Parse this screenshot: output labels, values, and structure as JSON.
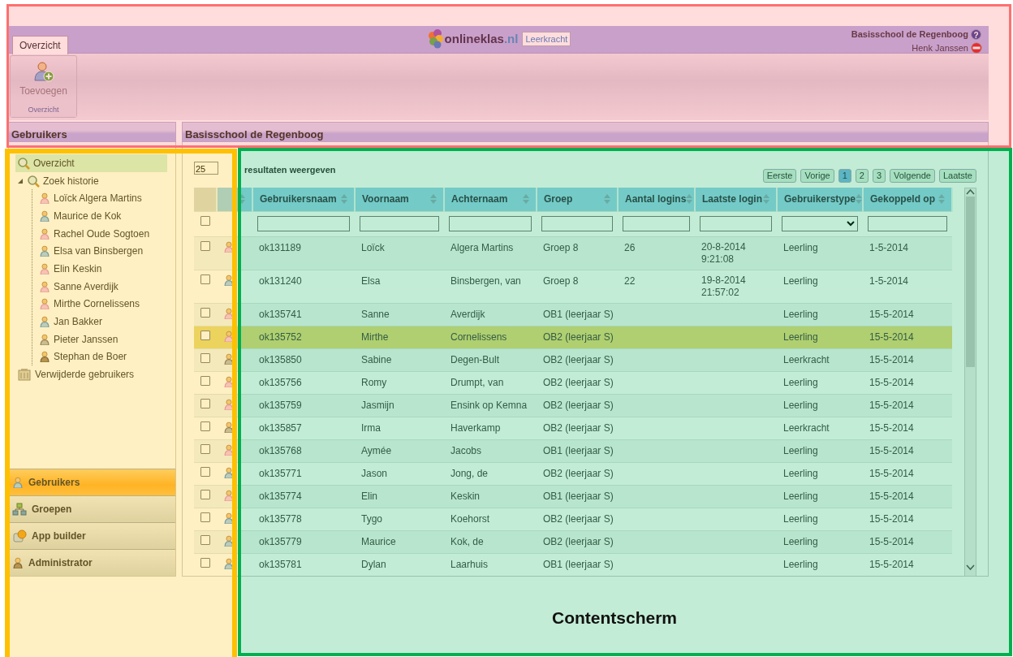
{
  "header": {
    "tab": {
      "label": "Overzicht",
      "selected": true
    },
    "logo_name": "onlineklas",
    "logo_domain": ".nl",
    "role_badge": "Leerkracht",
    "school": "Basisschool de Regenboog",
    "help_icon": "?",
    "user": "Henk Janssen"
  },
  "toolbar": {
    "buttons": [
      {
        "label": "Toevoegen"
      }
    ],
    "group_label": "Overzicht"
  },
  "sidebar": {
    "title": "Gebruikers",
    "tree": [
      {
        "label": "Overzicht",
        "kind": "overview",
        "selected": true
      },
      {
        "label": "Zoek historie",
        "kind": "search",
        "selected": false,
        "expanded": true,
        "children": [
          {
            "label": "Loïck Algera Martins",
            "kind": "girl",
            "selected": false
          },
          {
            "label": "Maurice de Kok",
            "kind": "boy",
            "selected": false
          },
          {
            "label": "Rachel Oude Sogtoen",
            "kind": "girl",
            "selected": false
          },
          {
            "label": "Elsa van Binsbergen",
            "kind": "boy",
            "selected": false
          },
          {
            "label": "Elin Keskin",
            "kind": "girl",
            "selected": false
          },
          {
            "label": "Sanne Averdijk",
            "kind": "girl",
            "selected": false
          },
          {
            "label": "Mirthe Cornelissens",
            "kind": "girl",
            "selected": false
          },
          {
            "label": "Jan Bakker",
            "kind": "boy",
            "selected": false
          },
          {
            "label": "Pieter Janssen",
            "kind": "teacher",
            "selected": false
          },
          {
            "label": "Stephan de Boer",
            "kind": "admin",
            "selected": false
          }
        ]
      },
      {
        "label": "Verwijderde gebruikers",
        "kind": "deleted",
        "selected": false
      }
    ],
    "nav": [
      {
        "label": "Gebruikers",
        "kind": "users",
        "selected": true
      },
      {
        "label": "Groepen",
        "kind": "groups",
        "selected": false
      },
      {
        "label": "App builder",
        "kind": "apps",
        "selected": false
      },
      {
        "label": "Administrator",
        "kind": "admin",
        "selected": false
      }
    ]
  },
  "content": {
    "title": "Basisschool de Regenboog",
    "page_size": "25",
    "page_size_label": "resultaten weergeven",
    "pager": [
      {
        "label": "Eerste",
        "selected": false
      },
      {
        "label": "Vorige",
        "selected": false
      },
      {
        "label": "1",
        "selected": true
      },
      {
        "label": "2",
        "selected": false
      },
      {
        "label": "3",
        "selected": false
      },
      {
        "label": "Volgende",
        "selected": false
      },
      {
        "label": "Laatste",
        "selected": false
      }
    ],
    "table": {
      "select_all": {
        "checked": false
      },
      "columns": [
        {
          "label": "Gebruikersnaam",
          "kind": "text"
        },
        {
          "label": "Voornaam",
          "kind": "text"
        },
        {
          "label": "Achternaam",
          "kind": "text"
        },
        {
          "label": "Groep",
          "kind": "text"
        },
        {
          "label": "Aantal logins",
          "kind": "text"
        },
        {
          "label": "Laatste login",
          "kind": "text"
        },
        {
          "label": "Gebruikerstype",
          "kind": "select"
        },
        {
          "label": "Gekoppeld op",
          "kind": "text"
        }
      ],
      "rows": [
        {
          "kind": "girl",
          "checked": false,
          "selected": false,
          "cells": [
            "ok131189",
            "Loïck",
            "Algera Martins",
            "Groep 8",
            "26",
            "20-8-2014 9:21:08",
            "Leerling",
            "1-5-2014"
          ]
        },
        {
          "kind": "boy",
          "checked": false,
          "selected": false,
          "cells": [
            "ok131240",
            "Elsa",
            "Binsbergen, van",
            "Groep 8",
            "22",
            "19-8-2014 21:57:02",
            "Leerling",
            "1-5-2014"
          ]
        },
        {
          "kind": "girl",
          "checked": false,
          "selected": false,
          "cells": [
            "ok135741",
            "Sanne",
            "Averdijk",
            "OB1 (leerjaar S)",
            "",
            "",
            "Leerling",
            "15-5-2014"
          ]
        },
        {
          "kind": "girl",
          "checked": false,
          "selected": true,
          "cells": [
            "ok135752",
            "Mirthe",
            "Cornelissens",
            "OB2 (leerjaar S)",
            "",
            "",
            "Leerling",
            "15-5-2014"
          ]
        },
        {
          "kind": "teacher",
          "checked": false,
          "selected": false,
          "cells": [
            "ok135850",
            "Sabine",
            "Degen-Bult",
            "OB2 (leerjaar S)",
            "",
            "",
            "Leerkracht",
            "15-5-2014"
          ]
        },
        {
          "kind": "girl",
          "checked": false,
          "selected": false,
          "cells": [
            "ok135756",
            "Romy",
            "Drumpt, van",
            "OB2 (leerjaar S)",
            "",
            "",
            "Leerling",
            "15-5-2014"
          ]
        },
        {
          "kind": "girl",
          "checked": false,
          "selected": false,
          "cells": [
            "ok135759",
            "Jasmijn",
            "Ensink op Kemna",
            "OB2 (leerjaar S)",
            "",
            "",
            "Leerling",
            "15-5-2014"
          ]
        },
        {
          "kind": "teacher",
          "checked": false,
          "selected": false,
          "cells": [
            "ok135857",
            "Irma",
            "Haverkamp",
            "OB2 (leerjaar S)",
            "",
            "",
            "Leerkracht",
            "15-5-2014"
          ]
        },
        {
          "kind": "girl",
          "checked": false,
          "selected": false,
          "cells": [
            "ok135768",
            "Aymée",
            "Jacobs",
            "OB1 (leerjaar S)",
            "",
            "",
            "Leerling",
            "15-5-2014"
          ]
        },
        {
          "kind": "boy",
          "checked": false,
          "selected": false,
          "cells": [
            "ok135771",
            "Jason",
            "Jong, de",
            "OB2 (leerjaar S)",
            "",
            "",
            "Leerling",
            "15-5-2014"
          ]
        },
        {
          "kind": "girl",
          "checked": false,
          "selected": false,
          "cells": [
            "ok135774",
            "Elin",
            "Keskin",
            "OB1 (leerjaar S)",
            "",
            "",
            "Leerling",
            "15-5-2014"
          ]
        },
        {
          "kind": "boy",
          "checked": false,
          "selected": false,
          "cells": [
            "ok135778",
            "Tygo",
            "Koehorst",
            "OB2 (leerjaar S)",
            "",
            "",
            "Leerling",
            "15-5-2014"
          ]
        },
        {
          "kind": "boy",
          "checked": false,
          "selected": false,
          "cells": [
            "ok135779",
            "Maurice",
            "Kok, de",
            "OB2 (leerjaar S)",
            "",
            "",
            "Leerling",
            "15-5-2014"
          ]
        },
        {
          "kind": "boy",
          "checked": false,
          "selected": false,
          "cells": [
            "ok135781",
            "Dylan",
            "Laarhuis",
            "OB1 (leerjaar S)",
            "",
            "",
            "Leerling",
            "15-5-2014"
          ]
        }
      ]
    }
  },
  "annotations": [
    {
      "kind": "header",
      "color": "#ff7070"
    },
    {
      "kind": "sidebar",
      "color": "#ffc000"
    },
    {
      "kind": "content",
      "color": "#00b050",
      "label": "Contentscherm"
    }
  ]
}
